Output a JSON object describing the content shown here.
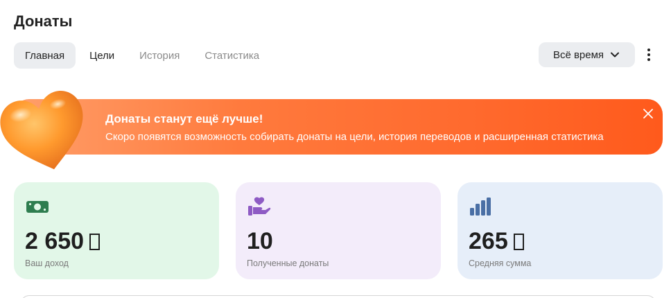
{
  "page": {
    "title": "Донаты"
  },
  "tabs": [
    {
      "label": "Главная",
      "active": true
    },
    {
      "label": "Цели",
      "active": false
    },
    {
      "label": "История",
      "active": false
    },
    {
      "label": "Статистика",
      "active": false
    }
  ],
  "period": {
    "label": "Всё время",
    "icon": "chevron-down-icon"
  },
  "menu": {
    "icon": "more-vertical-icon"
  },
  "banner": {
    "title": "Донаты станут ещё лучше!",
    "text": "Скоро появятся возможность собирать донаты на цели, история переводов и расширенная статистика",
    "close_icon": "close-icon",
    "illustration": "heart-icon",
    "gradient": [
      "#ff9f6a",
      "#ff5a1c"
    ]
  },
  "stats": [
    {
      "value": "2 650",
      "currency_glyph": true,
      "label": "Ваш доход",
      "icon": "money-icon",
      "color": "#e2f7e8",
      "icon_color": "#2e7d4f"
    },
    {
      "value": "10",
      "currency_glyph": false,
      "label": "Полученные донаты",
      "icon": "hand-heart-icon",
      "color": "#f3ecfa",
      "icon_color": "#8e5bc4"
    },
    {
      "value": "265",
      "currency_glyph": true,
      "label": "Средняя сумма",
      "icon": "bar-chart-icon",
      "color": "#e6eef9",
      "icon_color": "#4a6fa5"
    }
  ]
}
